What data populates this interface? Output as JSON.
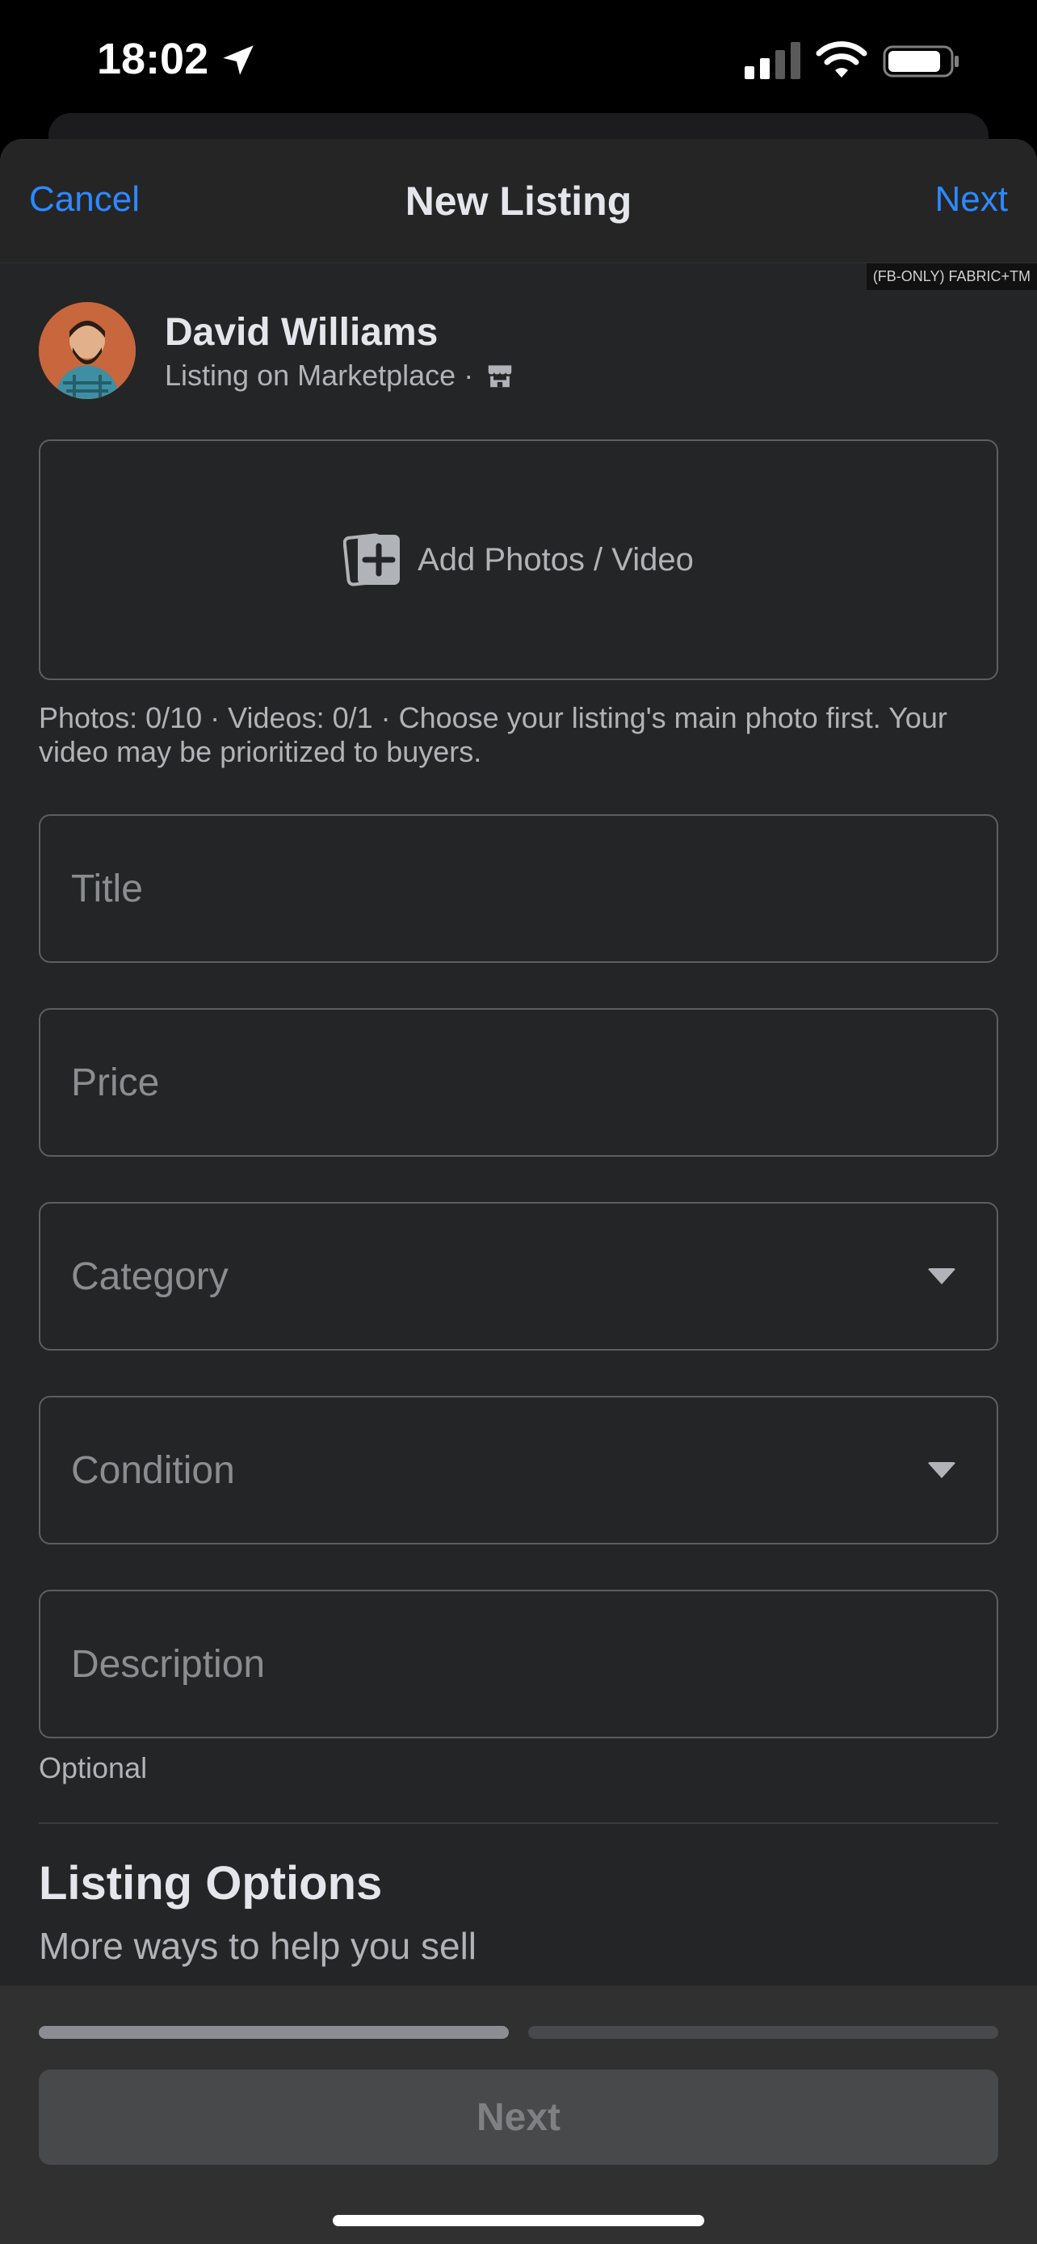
{
  "status_bar": {
    "time": "18:02",
    "icons": [
      "location-arrow-icon",
      "signal-icon",
      "wifi-icon",
      "battery-icon"
    ]
  },
  "nav": {
    "cancel_label": "Cancel",
    "title": "New Listing",
    "next_label": "Next"
  },
  "debug_badge": "(FB-ONLY) FABRIC+TM",
  "profile": {
    "name": "David Williams",
    "subtitle": "Listing on Marketplace ·",
    "subtitle_icon": "storefront-icon"
  },
  "photos": {
    "add_label": "Add Photos / Video",
    "hint": "Photos: 0/10 · Videos: 0/1 · Choose your listing's main photo first. Your video may be prioritized to buyers."
  },
  "fields": {
    "title_placeholder": "Title",
    "price_placeholder": "Price",
    "category_placeholder": "Category",
    "condition_placeholder": "Condition",
    "description_placeholder": "Description",
    "description_note": "Optional"
  },
  "listing_options": {
    "title": "Listing Options",
    "subtitle": "More ways to help you sell"
  },
  "footer": {
    "progress_step": 1,
    "progress_total": 2,
    "next_label": "Next"
  },
  "colors": {
    "background": "#242526",
    "accent": "#2e89ff",
    "text_primary": "#e4e6eb",
    "text_secondary": "#b0b3b8",
    "border": "#5c5e62"
  }
}
